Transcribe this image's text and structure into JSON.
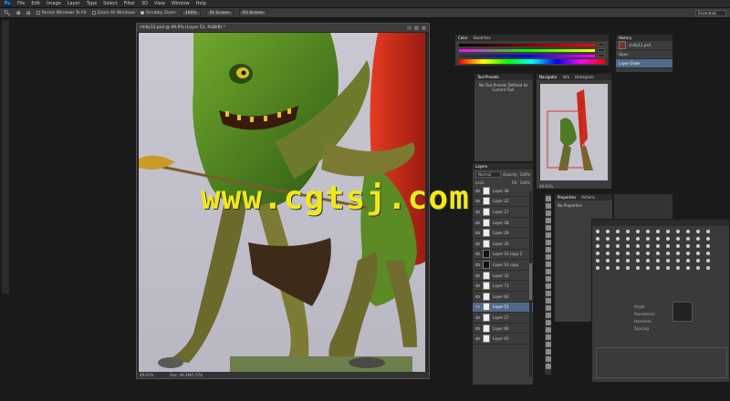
{
  "app": {
    "logo": "Ps"
  },
  "menu": [
    "File",
    "Edit",
    "Image",
    "Layer",
    "Type",
    "Select",
    "Filter",
    "3D",
    "View",
    "Window",
    "Help"
  ],
  "options": {
    "resize_windows": "Resize Windows To Fit",
    "zoom_all": "Zoom All Windows",
    "scrubby": "Scrubby Zoom",
    "pct": "100%",
    "fit": "Fit Screen",
    "fill": "Fill Screen",
    "workspace": "Essentials"
  },
  "document": {
    "title": "chilly12.psd @ 49.6% (Layer 51, RGB/8) *",
    "zoom": "49.61%",
    "doc_info": "Doc: 46.2M/1.57G"
  },
  "color_panel": {
    "tabs": [
      "Color",
      "Swatches"
    ]
  },
  "tool_presets": {
    "title": "Tool Presets",
    "message": "No Tool Presets Defined for Current Tool."
  },
  "navigator": {
    "tabs": [
      "Navigator",
      "Info",
      "Histogram"
    ],
    "zoom": "49.61%"
  },
  "history": {
    "tabs": [
      "History"
    ],
    "file": "chilly12.psd",
    "items": [
      "Open",
      "Layer Order"
    ]
  },
  "layers": {
    "tabs": [
      "Layers"
    ],
    "mode": "Normal",
    "opacity_label": "Opacity:",
    "opacity": "100%",
    "lock_label": "Lock:",
    "fill_label": "Fill:",
    "fill": "100%",
    "rows": [
      {
        "name": "Layer 36",
        "thumb": "white"
      },
      {
        "name": "Layer 22",
        "thumb": "white"
      },
      {
        "name": "Layer 27",
        "thumb": "white"
      },
      {
        "name": "Layer 28",
        "thumb": "white"
      },
      {
        "name": "Layer 29",
        "thumb": "white"
      },
      {
        "name": "Layer 26",
        "thumb": "white"
      },
      {
        "name": "Layer 16 copy 2",
        "thumb": "black"
      },
      {
        "name": "Layer 16 copy",
        "thumb": "black"
      },
      {
        "name": "Layer 32",
        "thumb": "white"
      },
      {
        "name": "Layer 73",
        "thumb": "white"
      },
      {
        "name": "Layer 60",
        "thumb": "white"
      },
      {
        "name": "Layer 51",
        "thumb": "white",
        "selected": true
      },
      {
        "name": "Layer 57",
        "thumb": "white"
      },
      {
        "name": "Layer 66",
        "thumb": "white"
      },
      {
        "name": "Layer 43",
        "thumb": "white"
      }
    ]
  },
  "properties": {
    "tabs": [
      "Properties",
      "Actions"
    ],
    "message": "No Properties"
  },
  "brush": {
    "labels": [
      "Angle:",
      "Roundness:",
      "Hardness",
      "Spacing"
    ]
  },
  "watermark": "www.cgtsj.com",
  "colors": {
    "accent": "#4d6d93",
    "watermark": "#f0e81a",
    "chili_green": "#4d7a22",
    "chili_red": "#c8291b"
  }
}
